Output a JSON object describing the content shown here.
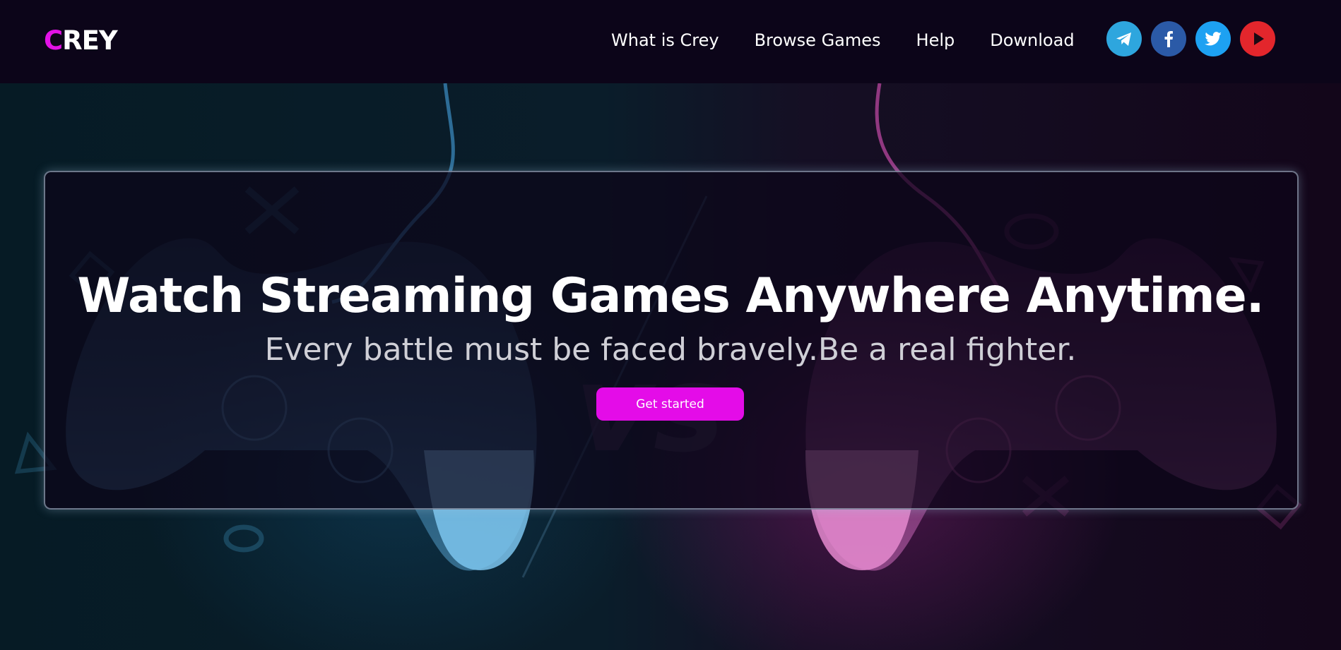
{
  "header": {
    "logo_first": "C",
    "logo_rest": "REY",
    "nav": [
      {
        "label": "What is Crey"
      },
      {
        "label": "Browse Games"
      },
      {
        "label": "Help"
      },
      {
        "label": "Download"
      }
    ],
    "socials": [
      {
        "icon": "telegram-icon",
        "color": "#2ea6de"
      },
      {
        "icon": "facebook-icon",
        "color": "#2b5aa7"
      },
      {
        "icon": "twitter-icon",
        "color": "#1da1f2"
      },
      {
        "icon": "youtube-icon",
        "color": "#e3262c"
      }
    ]
  },
  "hero": {
    "title": "Watch Streaming Games Anywhere Anytime.",
    "subtitle": "Every battle must be faced bravely.Be a real fighter.",
    "cta_label": "Get started"
  },
  "colors": {
    "accent": "#e212e6",
    "header_bg": "#0c0519",
    "cta_bg": "#e40ce8"
  }
}
